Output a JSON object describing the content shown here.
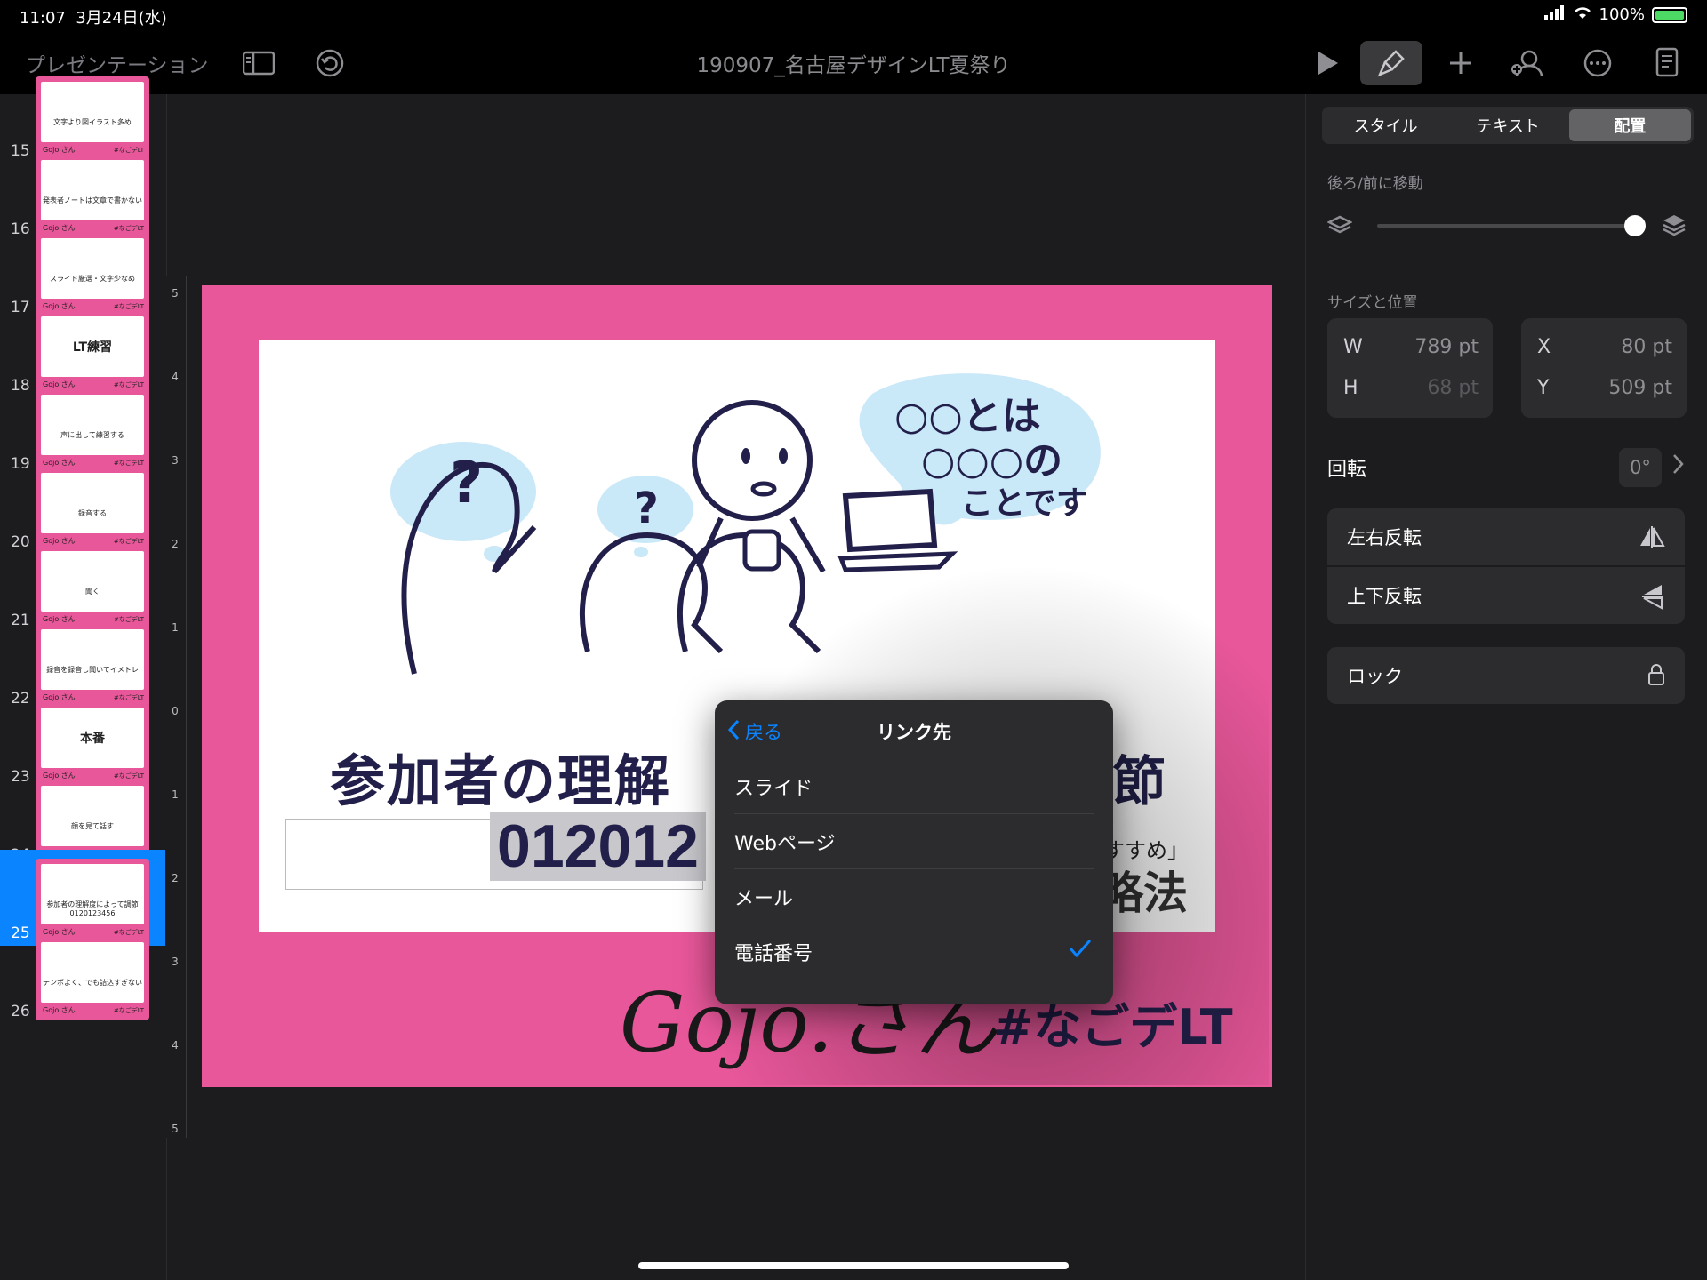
{
  "status": {
    "time": "11:07",
    "date": "3月24日(水)",
    "battery": "100%"
  },
  "toolbar": {
    "app_name": "プレゼンテーション",
    "doc_title": "190907_名古屋デザインLT夏祭り"
  },
  "sidebar": {
    "slides": [
      {
        "num": "15",
        "text": "文字より図イラスト多め"
      },
      {
        "num": "16",
        "text": "発表者ノートは文章で書かない"
      },
      {
        "num": "17",
        "text": "スライド厳選・文字少なめ"
      },
      {
        "num": "18",
        "text": "LT練習",
        "big": true
      },
      {
        "num": "19",
        "text": "声に出して練習する"
      },
      {
        "num": "20",
        "text": "録音する"
      },
      {
        "num": "21",
        "text": "聞く"
      },
      {
        "num": "22",
        "text": "録音を録音し聞いてイメトレ"
      },
      {
        "num": "23",
        "text": "本番",
        "big": true
      },
      {
        "num": "24",
        "text": "顔を見て話す"
      },
      {
        "num": "25",
        "text": "参加者の理解度によって調節 0120123456",
        "selected": true
      },
      {
        "num": "26",
        "text": "テンポよく、でも詰込すぎない"
      }
    ]
  },
  "ruler": [
    "5",
    "4",
    "3",
    "2",
    "1",
    "0",
    "1",
    "2",
    "3",
    "4",
    "5"
  ],
  "slide": {
    "bubble_text_1": "○○とは",
    "bubble_text_2": "○○○の",
    "bubble_text_3": "ことです",
    "question": "?",
    "title": "参加者の理解",
    "title_tail": "節",
    "phone": "012012",
    "tail_small": "すすめ」",
    "tail_big": "略法",
    "logo": "Gojo.さん",
    "hashtag": "#なごデLT"
  },
  "popover": {
    "back_label": "戻る",
    "title": "リンク先",
    "items": [
      {
        "label": "スライド"
      },
      {
        "label": "Webページ"
      },
      {
        "label": "メール"
      },
      {
        "label": "電話番号",
        "checked": true
      }
    ]
  },
  "inspector": {
    "tabs": [
      "スタイル",
      "テキスト",
      "配置"
    ],
    "active_tab": "配置",
    "move_label": "後ろ/前に移動",
    "size_label": "サイズと位置",
    "w_label": "W",
    "w_value": "789 pt",
    "h_label": "H",
    "h_value": "68 pt",
    "x_label": "X",
    "x_value": "80 pt",
    "y_label": "Y",
    "y_value": "509 pt",
    "rotate_label": "回転",
    "rotate_value": "0°",
    "flip_h": "左右反転",
    "flip_v": "上下反転",
    "lock": "ロック"
  },
  "colors": {
    "accent": "#0a84ff",
    "slide_pink": "#e8579a",
    "ink": "#22204a",
    "bubble": "#c9e8f8"
  }
}
